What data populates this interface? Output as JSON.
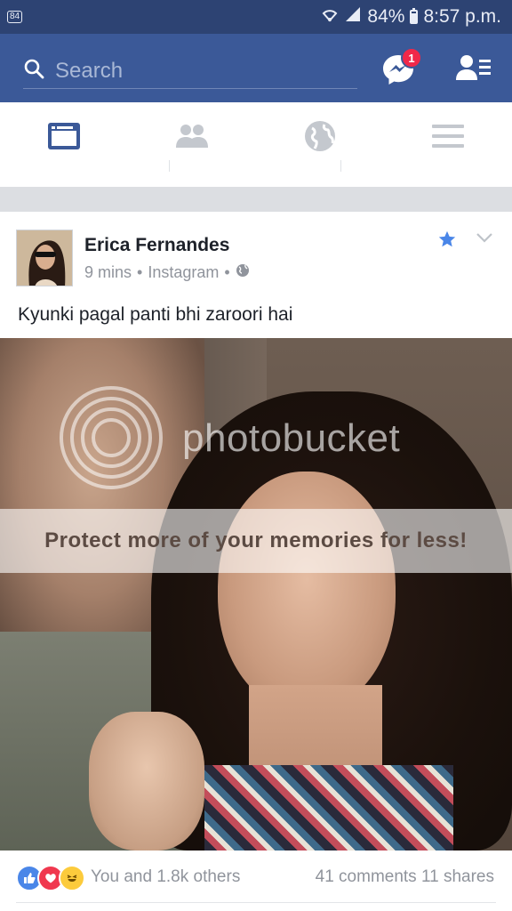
{
  "status_bar": {
    "notification": "84",
    "battery": "84%",
    "time": "8:57 p.m."
  },
  "header": {
    "search_placeholder": "Search",
    "messenger_badge": "1",
    "colors": {
      "bar": "#3b5998",
      "badge": "#f02849"
    }
  },
  "tabs": [
    {
      "name": "news-feed-icon",
      "active": true
    },
    {
      "name": "friends-icon",
      "active": false
    },
    {
      "name": "notifications-globe-icon",
      "active": false
    },
    {
      "name": "menu-icon",
      "active": false
    }
  ],
  "post": {
    "author": "Erica Fernandes",
    "time": "9 mins",
    "source": "Instagram",
    "text": "Kyunki pagal panti bhi zaroori hai",
    "photo": {
      "watermark_brand": "photobucket",
      "watermark_banner": "Protect more of your memories for less!"
    },
    "reactions_text": "You and 1.8k others",
    "comments": "41 comments",
    "shares": "11 shares"
  }
}
